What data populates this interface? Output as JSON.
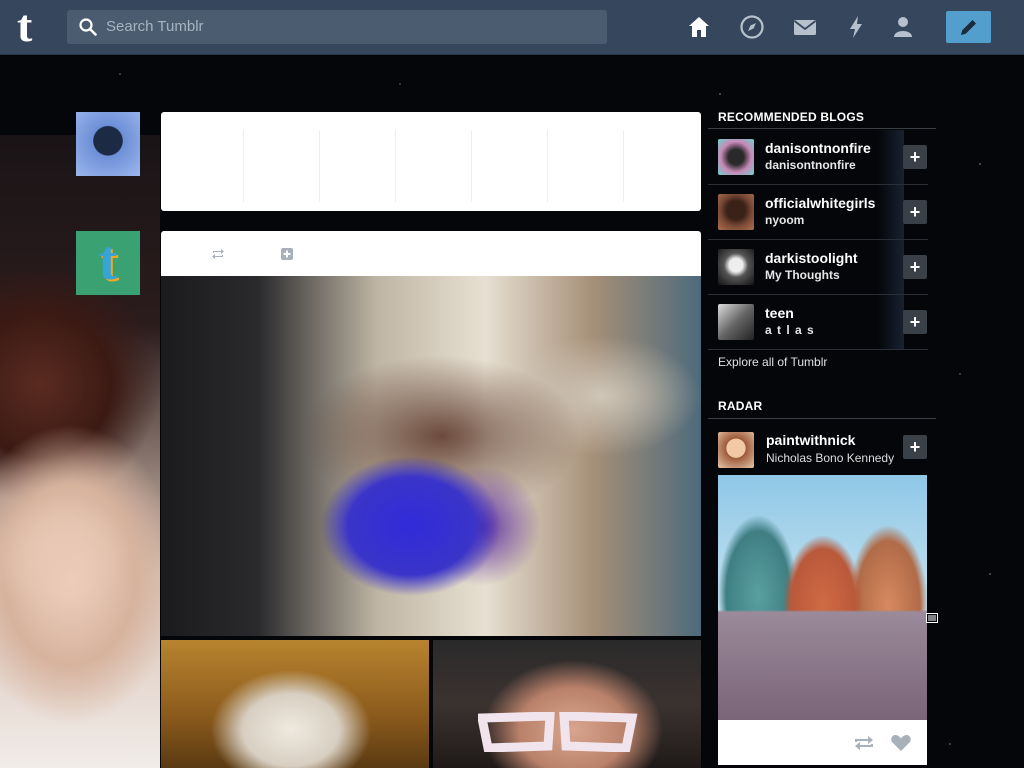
{
  "header": {
    "logo": "t",
    "search_placeholder": "Search Tumblr",
    "nav_icons": [
      "home-icon",
      "explore-icon",
      "inbox-icon",
      "activity-icon",
      "account-icon"
    ],
    "compose_icon": "pencil-icon",
    "bg_color": "#36465d",
    "compose_color": "#529ecc"
  },
  "sidebar_left": {
    "user_avatar": "user-avatar",
    "blog_avatar_letter": "t"
  },
  "recommended": {
    "title": "RECOMMENDED BLOGS",
    "items": [
      {
        "name": "danisontnonfire",
        "subtitle": "danisontnonfire"
      },
      {
        "name": "officialwhitegirls",
        "subtitle": "nyoom"
      },
      {
        "name": "darkistoolight",
        "subtitle": "My Thoughts"
      },
      {
        "name": "teen",
        "subtitle": "a t l a s"
      }
    ],
    "follow_symbol": "+",
    "explore_link": "Explore all of Tumblr"
  },
  "radar": {
    "title": "RADAR",
    "blog_name": "paintwithnick",
    "blog_subtitle": "Nicholas Bono Kennedy",
    "follow_symbol": "+"
  }
}
